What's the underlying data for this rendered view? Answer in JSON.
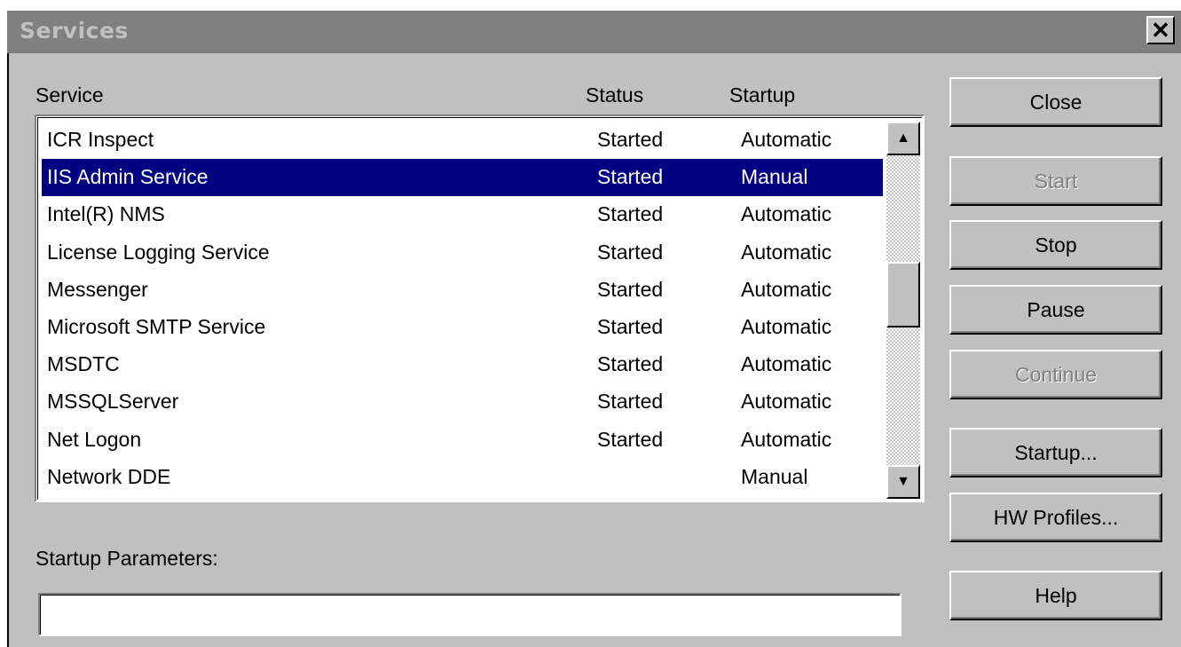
{
  "window": {
    "title": "Services",
    "close_glyph": "✕"
  },
  "headers": {
    "service": "Service",
    "status": "Status",
    "startup": "Startup"
  },
  "services": [
    {
      "name": "ICR Inspect",
      "status": "Started",
      "startup": "Automatic"
    },
    {
      "name": "IIS Admin Service",
      "status": "Started",
      "startup": "Manual",
      "selected": true
    },
    {
      "name": "Intel(R) NMS",
      "status": "Started",
      "startup": "Automatic"
    },
    {
      "name": "License Logging Service",
      "status": "Started",
      "startup": "Automatic"
    },
    {
      "name": "Messenger",
      "status": "Started",
      "startup": "Automatic"
    },
    {
      "name": "Microsoft SMTP Service",
      "status": "Started",
      "startup": "Automatic"
    },
    {
      "name": "MSDTC",
      "status": "Started",
      "startup": "Automatic"
    },
    {
      "name": "MSSQLServer",
      "status": "Started",
      "startup": "Automatic"
    },
    {
      "name": "Net Logon",
      "status": "Started",
      "startup": "Automatic"
    },
    {
      "name": "Network DDE",
      "status": "",
      "startup": "Manual"
    }
  ],
  "buttons": {
    "close": "Close",
    "start": "Start",
    "stop": "Stop",
    "pause": "Pause",
    "continue": "Continue",
    "startup": "Startup...",
    "hw_profiles": "HW Profiles...",
    "help": "Help"
  },
  "startup_parameters": {
    "label": "Startup Parameters:",
    "value": ""
  },
  "colors": {
    "title_bg": "#808080",
    "face": "#c0c0c0",
    "selection": "#000080"
  },
  "icons": {
    "scroll_up": "▲",
    "scroll_down": "▼"
  }
}
